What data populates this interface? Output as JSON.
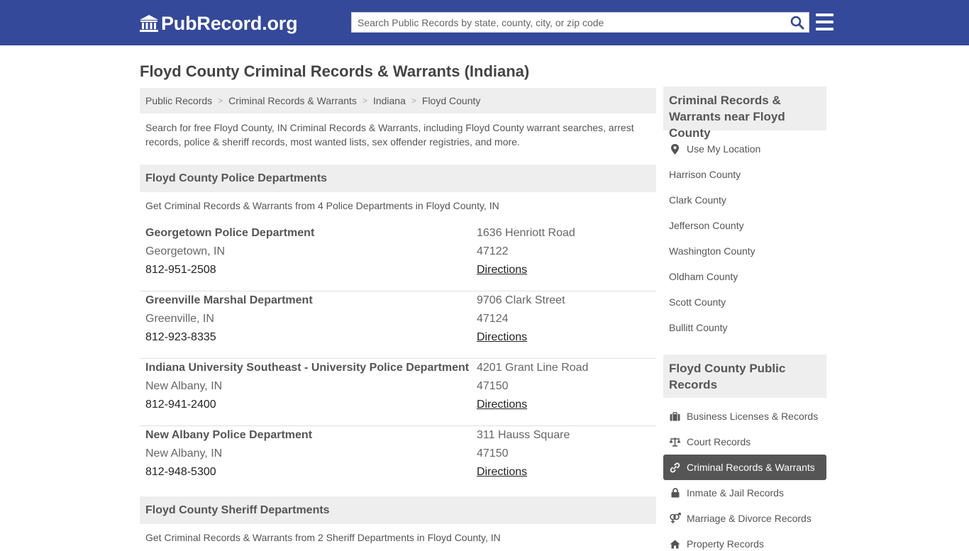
{
  "header": {
    "logo_text": "PubRecord.org",
    "search_placeholder": "Search Public Records by state, county, city, or zip code",
    "search_icon": "search-icon",
    "menu_icon": "hamburger-menu-icon",
    "brand_color": "#34499a"
  },
  "page": {
    "title": "Floyd County Criminal Records & Warrants (Indiana)",
    "breadcrumb": [
      "Public Records",
      "Criminal Records & Warrants",
      "Indiana",
      "Floyd County"
    ],
    "intro": "Search for free Floyd County, IN Criminal Records & Warrants, including Floyd County warrant searches, arrest records, police & sheriff records, most wanted lists, sex offender registries, and more."
  },
  "police": {
    "header": "Floyd County Police Departments",
    "subtitle": "Get Criminal Records & Warrants from 4 Police Departments in Floyd County, IN",
    "departments": [
      {
        "name": "Georgetown Police Department",
        "city": "Georgetown, IN",
        "phone": "812-951-2508",
        "address": "1636 Henriott Road",
        "zip": "47122",
        "directions": "Directions"
      },
      {
        "name": "Greenville Marshal Department",
        "city": "Greenville, IN",
        "phone": "812-923-8335",
        "address": "9706 Clark Street",
        "zip": "47124",
        "directions": "Directions"
      },
      {
        "name": "Indiana University Southeast - University Police Department",
        "city": "New Albany, IN",
        "phone": "812-941-2400",
        "address": "4201 Grant Line Road",
        "zip": "47150",
        "directions": "Directions"
      },
      {
        "name": "New Albany Police Department",
        "city": "New Albany, IN",
        "phone": "812-948-5300",
        "address": "311 Hauss Square",
        "zip": "47150",
        "directions": "Directions"
      }
    ]
  },
  "sheriff": {
    "header": "Floyd County Sheriff Departments",
    "subtitle": "Get Criminal Records & Warrants from 2 Sheriff Departments in Floyd County, IN"
  },
  "sidebar": {
    "nearby_title": "Criminal Records & Warrants near Floyd County",
    "use_location": "Use My Location",
    "nearby": [
      "Harrison County",
      "Clark County",
      "Jefferson County",
      "Washington County",
      "Oldham County",
      "Scott County",
      "Bullitt County"
    ],
    "records_title": "Floyd County Public Records",
    "records": [
      {
        "label": "Business Licenses & Records",
        "icon": "briefcase-icon"
      },
      {
        "label": "Court Records",
        "icon": "scales-icon"
      },
      {
        "label": "Criminal Records & Warrants",
        "icon": "link-icon",
        "active": true
      },
      {
        "label": "Inmate & Jail Records",
        "icon": "lock-icon"
      },
      {
        "label": "Marriage & Divorce Records",
        "icon": "venus-mars-icon"
      },
      {
        "label": "Property Records",
        "icon": "home-icon"
      }
    ]
  }
}
